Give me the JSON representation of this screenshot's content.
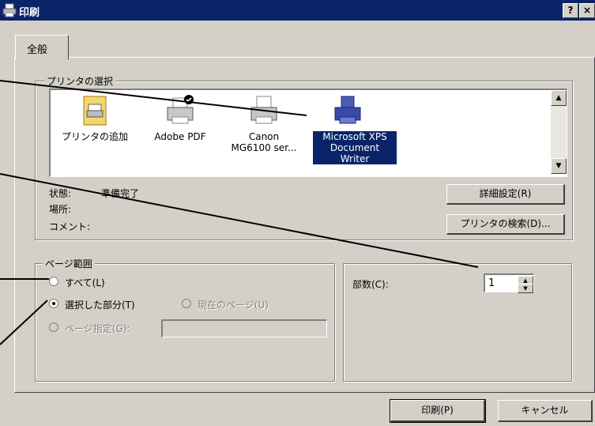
{
  "window": {
    "title": "印刷",
    "help_label": "?",
    "close_label": "×"
  },
  "tab": {
    "label": "全般"
  },
  "printer_group": {
    "legend": "プリンタの選択",
    "printers": [
      {
        "label": "プリンタの追加",
        "icon": "add-printer-icon"
      },
      {
        "label": "Adobe PDF",
        "icon": "printer-default-icon"
      },
      {
        "label": "Canon\nMG6100 ser...",
        "icon": "printer-icon"
      },
      {
        "label": "Microsoft XPS\nDocument\nWriter",
        "icon": "printer-blue-icon",
        "selected": true
      }
    ],
    "status_label": "状態:",
    "status_value": "準備完了",
    "location_label": "場所:",
    "comment_label": "コメント:",
    "details_button": "詳細設定(R)",
    "find_printer_button": "プリンタの検索(D)..."
  },
  "page_range": {
    "legend": "ページ範囲",
    "all": "すべて(L)",
    "selection": "選択した部分(T)",
    "current_page": "現在のページ(U)",
    "pages": "ページ指定(G):",
    "pages_value": ""
  },
  "copies": {
    "label": "部数(C):",
    "value": "1"
  },
  "footer": {
    "print_button": "印刷(P)",
    "cancel_button": "キャンセル"
  },
  "colors": {
    "title_bg": "#0a246a",
    "dialog_bg": "#d4d0c8",
    "selection": "#0a246a"
  }
}
